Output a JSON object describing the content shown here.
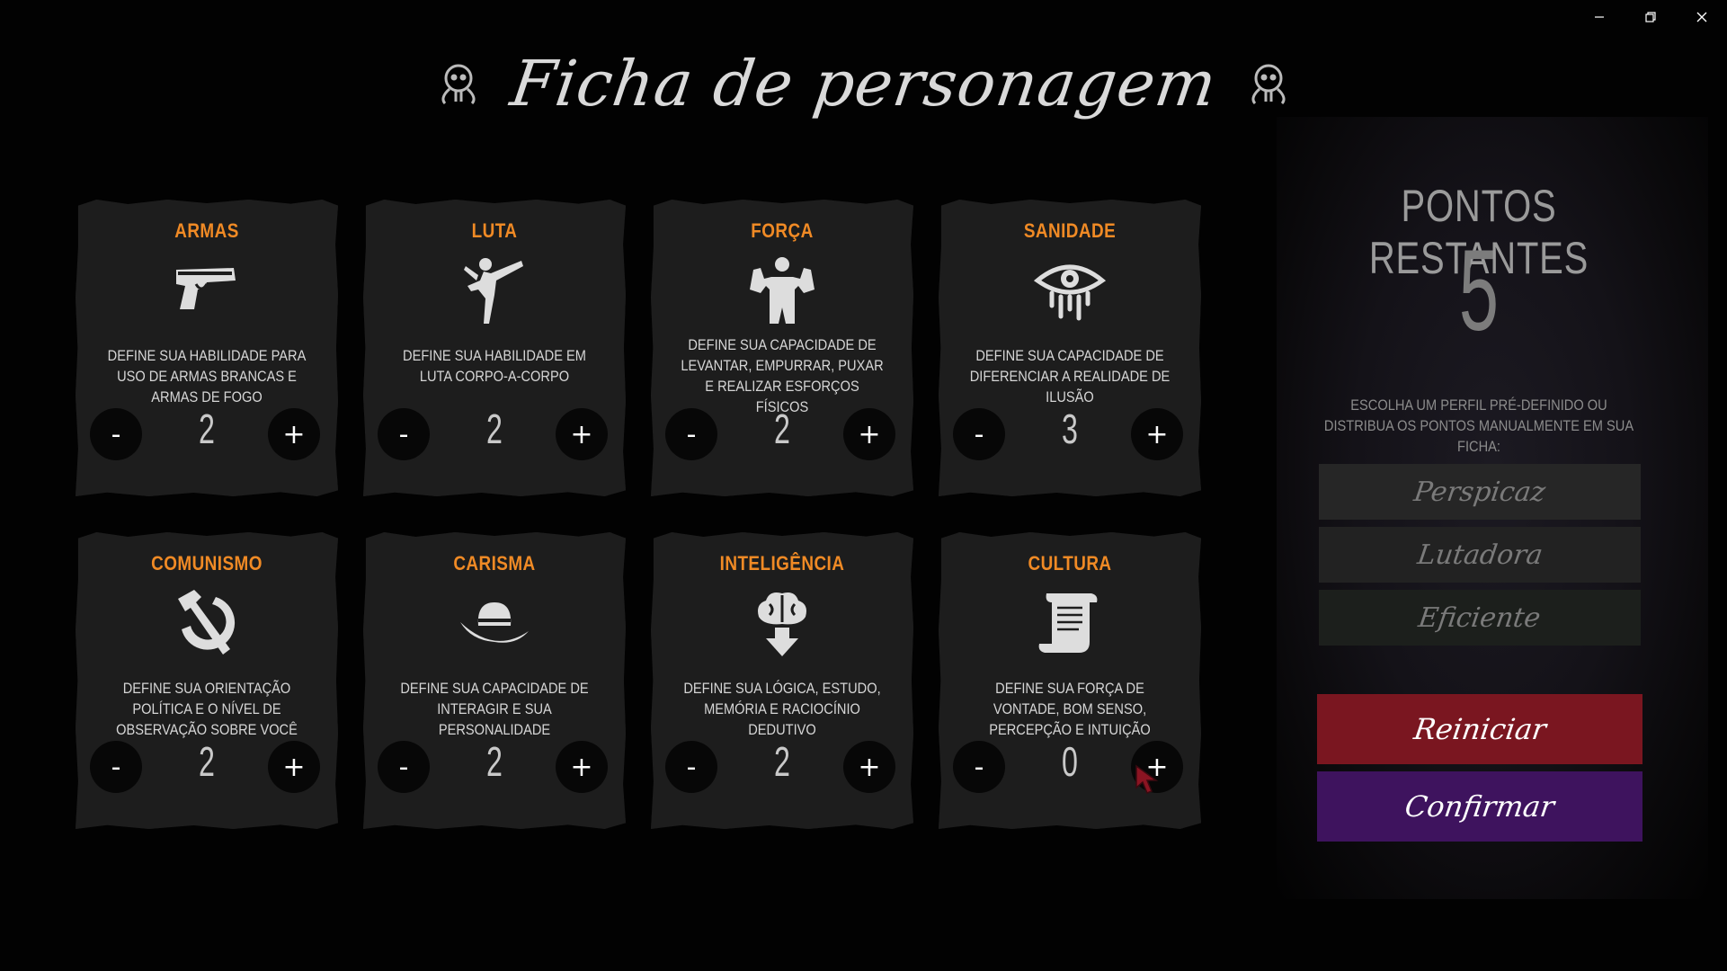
{
  "app": {
    "title": "Ficha de personagem"
  },
  "colors": {
    "accent_orange": "#f08a25",
    "card_bg": "#1d1d1d",
    "reset_red": "#7a1620",
    "confirm_purple": "#3e135e"
  },
  "attributes": [
    {
      "name": "ARMAS",
      "icon": "pistol-icon",
      "description": "DEFINE SUA HABILIDADE PARA USO DE ARMAS BRANCAS E ARMAS DE FOGO",
      "value": "2"
    },
    {
      "name": "LUTA",
      "icon": "fighter-kick-icon",
      "description": "DEFINE SUA HABILIDADE EM LUTA CORPO-A-CORPO",
      "value": "2"
    },
    {
      "name": "FORÇA",
      "icon": "flexing-muscles-icon",
      "description": "DEFINE SUA CAPACIDADE DE LEVANTAR, EMPURRAR, PUXAR E REALIZAR ESFORÇOS FÍSICOS",
      "value": "2"
    },
    {
      "name": "SANIDADE",
      "icon": "bleeding-eye-icon",
      "description": "DEFINE SUA CAPACIDADE DE DIFERENCIAR A REALIDADE DE ILUSÃO",
      "value": "3"
    },
    {
      "name": "COMUNISMO",
      "icon": "hammer-sickle-icon",
      "description": "DEFINE SUA ORIENTAÇÃO POLÍTICA E O NÍVEL DE OBSERVAÇÃO SOBRE VOCÊ",
      "value": "2"
    },
    {
      "name": "CARISMA",
      "icon": "fedora-hat-icon",
      "description": "DEFINE SUA CAPACIDADE DE INTERAGIR E SUA PERSONALIDADE",
      "value": "2"
    },
    {
      "name": "INTELIGÊNCIA",
      "icon": "brain-download-icon",
      "description": "DEFINE SUA LÓGICA, ESTUDO, MEMÓRIA E RACIOCÍNIO DEDUTIVO",
      "value": "2"
    },
    {
      "name": "CULTURA",
      "icon": "scroll-icon",
      "description": "DEFINE SUA FORÇA DE VONTADE, BOM SENSO, PERCEPÇÃO E INTUIÇÃO",
      "value": "0"
    }
  ],
  "buttons": {
    "minus": "-",
    "plus": "+"
  },
  "points": {
    "title": "PONTOS RESTANTES",
    "value": "5",
    "description": "ESCOLHA UM PERFIL PRÉ-DEFINIDO OU DISTRIBUA OS PONTOS MANUALMENTE EM SUA FICHA:"
  },
  "profiles": [
    "Perspicaz",
    "Lutadora",
    "Eficiente"
  ],
  "actions": {
    "reset": "Reiniciar",
    "confirm": "Confirmar"
  }
}
